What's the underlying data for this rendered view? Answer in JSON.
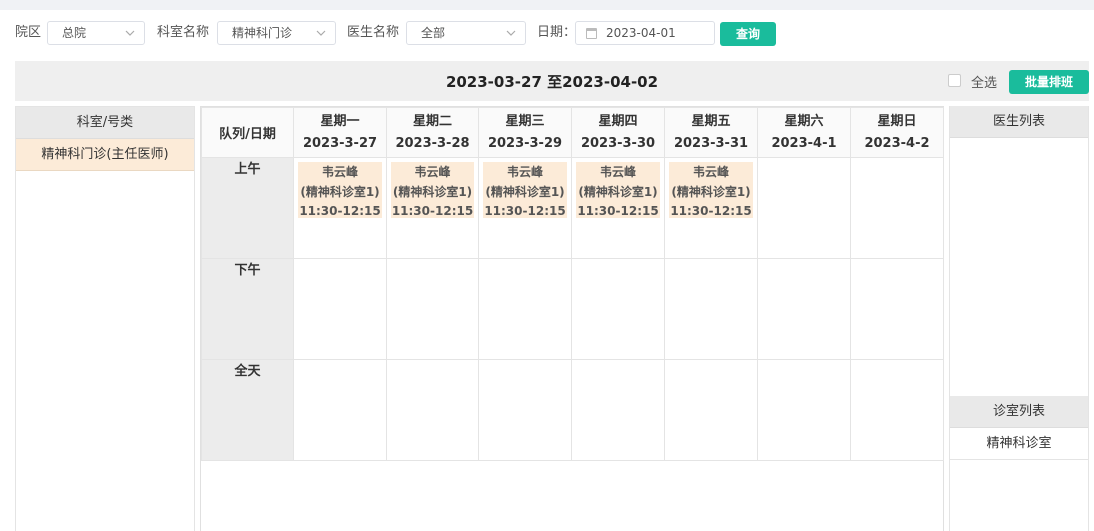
{
  "filters": {
    "campus_label": "院区",
    "campus_value": "总院",
    "dept_label": "科室名称",
    "dept_value": "精神科门诊",
    "doctor_label": "医生名称",
    "doctor_value": "全部",
    "date_label": "日期：",
    "date_value": "2023-04-01",
    "query_label": "查询"
  },
  "week": {
    "title": "2023-03-27 至2023-04-02",
    "select_all_label": "全选",
    "batch_label": "批量排班"
  },
  "left_panel": {
    "header": "科室/号类",
    "items": [
      "精神科门诊(主任医师)"
    ]
  },
  "grid": {
    "corner_label": "队列/日期",
    "days": [
      {
        "day": "星期一",
        "date": "2023-3-27"
      },
      {
        "day": "星期二",
        "date": "2023-3-28"
      },
      {
        "day": "星期三",
        "date": "2023-3-29"
      },
      {
        "day": "星期四",
        "date": "2023-3-30"
      },
      {
        "day": "星期五",
        "date": "2023-3-31"
      },
      {
        "day": "星期六",
        "date": "2023-4-1"
      },
      {
        "day": "星期日",
        "date": "2023-4-2"
      }
    ],
    "slots": [
      {
        "label": "上午",
        "cells": [
          {
            "doctor": "韦云峰",
            "room": "(精神科诊室1)",
            "time": "11:30-12:15"
          },
          {
            "doctor": "韦云峰",
            "room": "(精神科诊室1)",
            "time": "11:30-12:15"
          },
          {
            "doctor": "韦云峰",
            "room": "(精神科诊室1)",
            "time": "11:30-12:15"
          },
          {
            "doctor": "韦云峰",
            "room": "(精神科诊室1)",
            "time": "11:30-12:15"
          },
          {
            "doctor": "韦云峰",
            "room": "(精神科诊室1)",
            "time": "11:30-12:15"
          },
          null,
          null
        ]
      },
      {
        "label": "下午",
        "cells": [
          null,
          null,
          null,
          null,
          null,
          null,
          null
        ]
      },
      {
        "label": "全天",
        "cells": [
          null,
          null,
          null,
          null,
          null,
          null,
          null
        ]
      }
    ]
  },
  "right_panel": {
    "doctor_header": "医生列表",
    "room_header": "诊室列表",
    "rooms": [
      "精神科诊室"
    ]
  },
  "colors": {
    "accent": "#1abc9c",
    "card_bg": "#fcebd8",
    "header_bg": "#e9e9e9"
  }
}
